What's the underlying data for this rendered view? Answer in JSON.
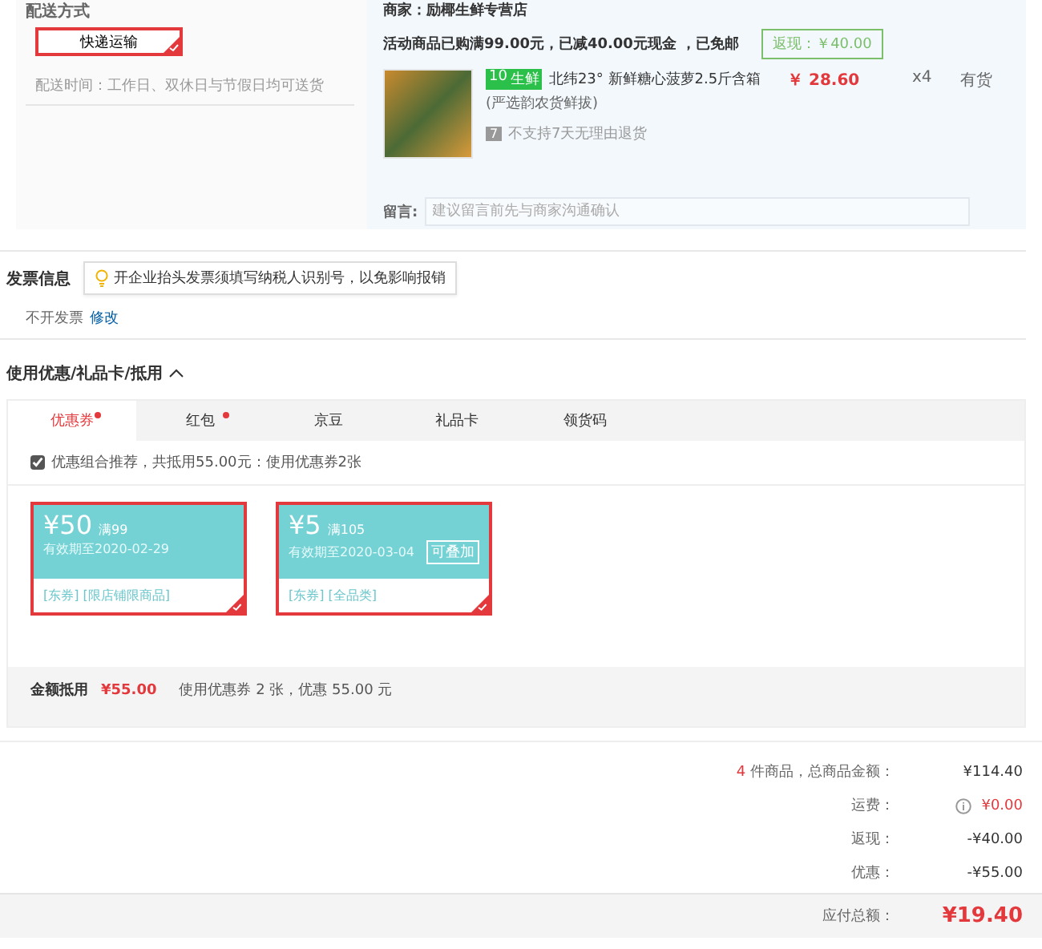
{
  "delivery": {
    "title": "配送方式",
    "option": {
      "label": "快递运输",
      "selected": true
    },
    "time_note": "配送时间：工作日、双休日与节假日均可送货"
  },
  "store": {
    "merchant": "商家：励椰生鲜专营店",
    "promo": "活动商品已购满99.00元，已减40.00元现金 ，已免邮",
    "cashback": "返现：￥40.00",
    "product": {
      "tag_icon": "10",
      "tag": "生鲜",
      "name": "北纬23° 新鲜糖心菠萝2.5斤含箱",
      "subtitle": "(严选韵农货鲜拔)",
      "return_icon": "7",
      "return_note": "不支持7天无理由退货",
      "price": "￥ 28.60",
      "quantity": "x4",
      "stock": "有货"
    },
    "message": {
      "label": "留言:",
      "placeholder": "建议留言前先与商家沟通确认"
    }
  },
  "invoice": {
    "title": "发票信息",
    "tip": "开企业抬头发票须填写纳税人识别号，以免影响报销",
    "status": "不开发票",
    "edit_link": "修改"
  },
  "discounts": {
    "title": "使用优惠/礼品卡/抵用",
    "expanded": true,
    "tabs": [
      {
        "label": "优惠券",
        "selected": true,
        "dot": true
      },
      {
        "label": "红包",
        "selected": false,
        "dot": true
      },
      {
        "label": "京豆",
        "selected": false,
        "dot": false
      },
      {
        "label": "礼品卡",
        "selected": false,
        "dot": false
      },
      {
        "label": "领货码",
        "selected": false,
        "dot": false
      }
    ],
    "recommend": {
      "checked": true,
      "label": "优惠组合推荐，共抵用55.00元：使用优惠券2张"
    },
    "coupons": [
      {
        "amount": "¥50",
        "condition": "满99",
        "validity": "有效期至2020-02-29",
        "tags": "[东券] [限店铺限商品]",
        "selected": true
      },
      {
        "amount": "¥5",
        "condition": "满105",
        "validity": "有效期至2020-03-04",
        "badge": "可叠加",
        "tags": "[东券] [全品类]",
        "selected": true
      }
    ],
    "summary": {
      "label": "金额抵用",
      "amount": "¥55.00",
      "note": "使用优惠券 2 张，优惠 55.00 元"
    }
  },
  "totals": {
    "count": "4",
    "count_label": " 件商品，总商品金额：",
    "rows": [
      {
        "label": "运费：",
        "value": "¥0.00",
        "kind": "shipping"
      },
      {
        "label": "返现：",
        "value": "-¥40.00",
        "kind": "plain"
      },
      {
        "label": "优惠：",
        "value": "-¥55.00",
        "kind": "plain"
      }
    ],
    "goods_total": "¥114.40",
    "payable_label": "应付总额：",
    "payable": "¥19.40"
  }
}
